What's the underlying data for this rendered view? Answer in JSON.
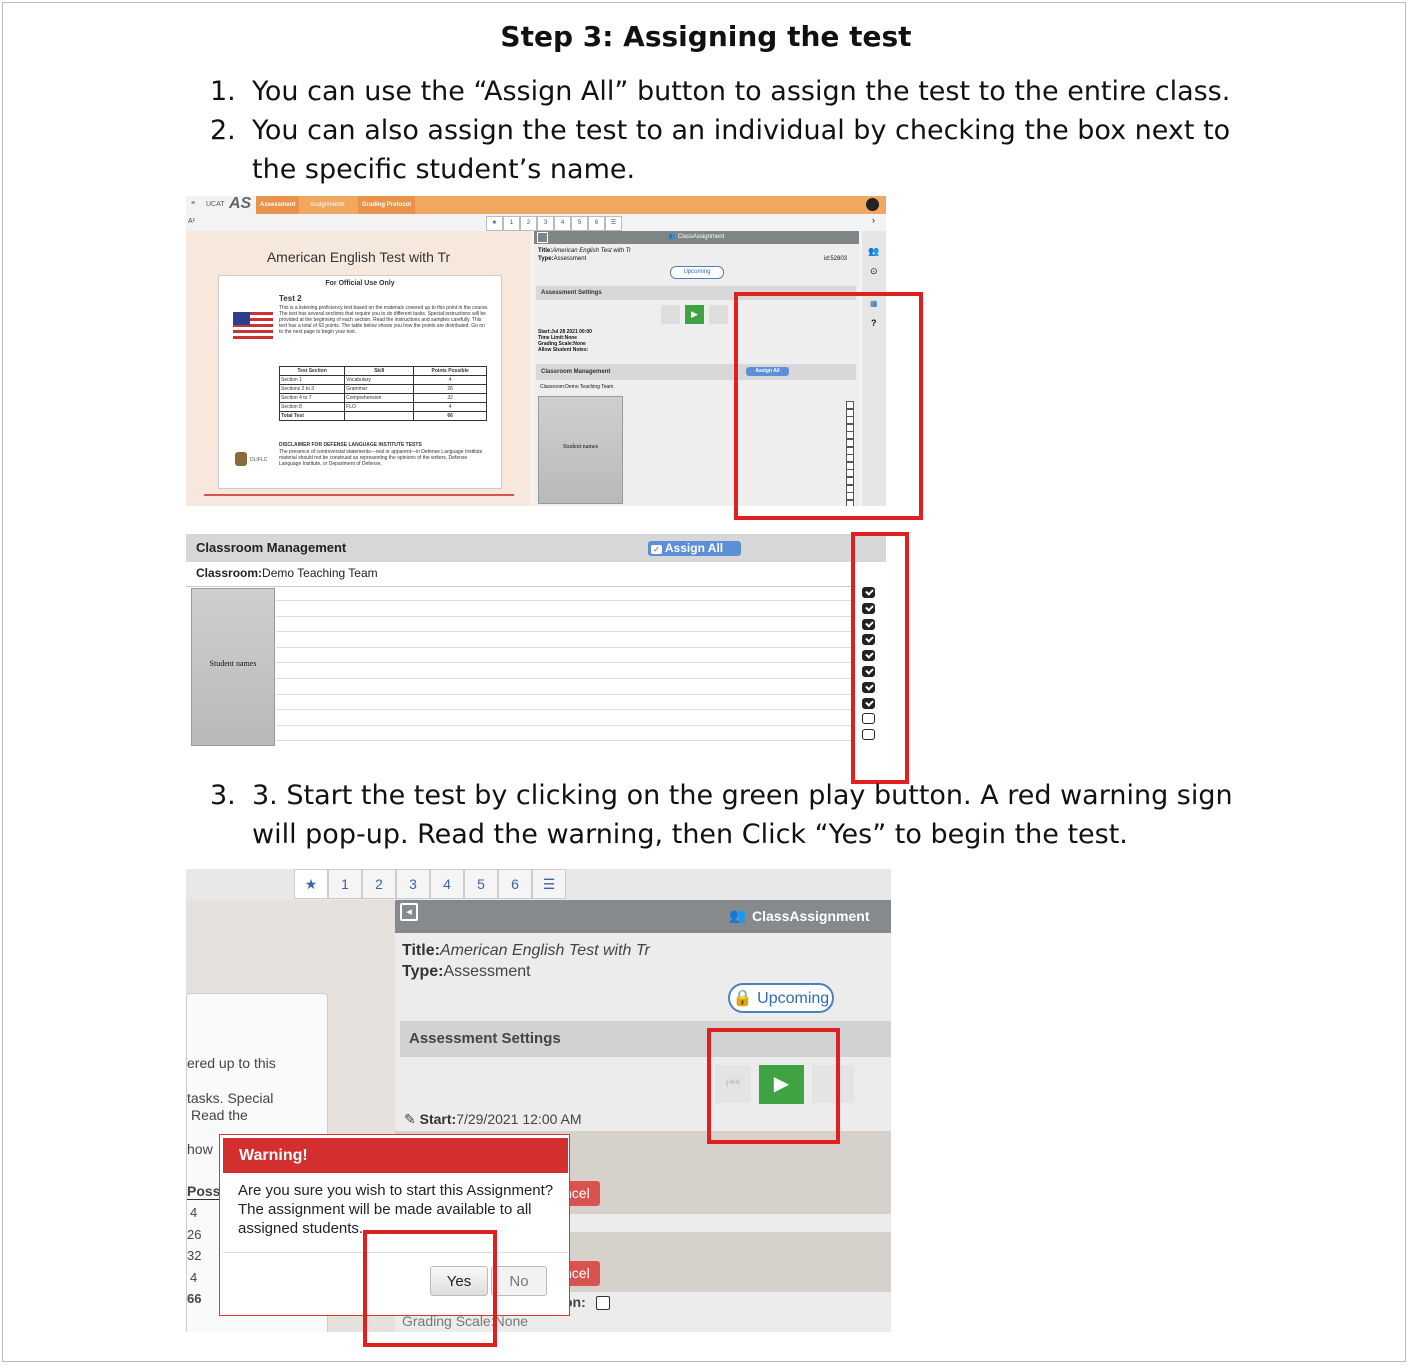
{
  "document": {
    "title": "Step 3: Assigning the test",
    "steps": [
      {
        "num": "1.",
        "text": "You can use the “Assign All” button to assign the test to the entire class."
      },
      {
        "num": "2.",
        "text": "You can also assign the test to an individual by checking the box next to the specific student’s name."
      },
      {
        "num": "3.",
        "text": "3. Start the test by clicking on the green play button. A red warning sign will pop-up. Read the warning, then  Click “Yes” to begin the test."
      }
    ]
  },
  "screenshot1": {
    "brand": "UCAT",
    "logo": "AS",
    "tabs": [
      "Assessment",
      "Assignments",
      "Grading Protocol"
    ],
    "toolbar_text": "A¹",
    "pager": [
      "1",
      "2",
      "3",
      "4",
      "5",
      "6"
    ],
    "test_title": "American English Test with Tr",
    "official": "For Official Use Only",
    "test_name": "Test 2",
    "test_desc": "This is a listening proficiency test based on the materials covered up to this point in the course. The test has several sections that require you to do different tasks. Special instructions will be provided at the beginning of each section. Read the instructions and samples carefully. This test has a total of 63 points. The table below shows you how the points are distributed. Go on to the next page to begin your test.",
    "table_headers": [
      "Test Section",
      "Skill",
      "Points Possible"
    ],
    "table_rows": [
      [
        "Section 1",
        "Vocabulary",
        "4"
      ],
      [
        "Sections 2 to 3",
        "Grammar",
        "26"
      ],
      [
        "Section 4 to 7",
        "Comprehension",
        "32"
      ],
      [
        "Section 8",
        "FLO",
        "4"
      ],
      [
        "Total Test",
        "",
        "66"
      ]
    ],
    "disclaimer_title": "DISCLAIMER FOR DEFENSE LANGUAGE INSTITUTE TESTS",
    "disclaimer_text": "The presence of controversial statements—real or apparent—in Defense Language Institute material should not be construed as representing the opinions of the writers, Defense Language Institute, or Department of Defense.",
    "dlifl": "DLIFLC",
    "panel_title": "ClassAssignment",
    "title_label": "Title:",
    "title_value": "American English Test with Tr",
    "type_label": "Type:",
    "type_value": "Assessment",
    "id_text": "id:52803",
    "upcoming": "Upcoming",
    "settings": "Assessment Settings",
    "start": "Start:Jul 28 2021 00:00",
    "time_limit": "Time Limit:None",
    "grading": "Grading Scale:None",
    "allow_notes": "Allow Student Notes:",
    "classroom_mgmt": "Classroom Management",
    "assign_all": "Assign All",
    "classroom": "Classroom:Demo Teaching Team",
    "student_names": "Student names"
  },
  "screenshot2": {
    "header": "Classroom Management",
    "assign_all": "Assign All",
    "classroom_label": "Classroom:",
    "classroom_value": "Demo Teaching Team",
    "student_names": "Student names",
    "checked": [
      true,
      true,
      true,
      true,
      true,
      true,
      true,
      true,
      false,
      false
    ]
  },
  "screenshot3": {
    "pager": [
      "1",
      "2",
      "3",
      "4",
      "5",
      "6"
    ],
    "panel_title": "ClassAssignment",
    "title_label": "Title:",
    "title_value": "American English Test with Tr",
    "type_label": "Type:",
    "type_value": "Assessment",
    "upcoming": "Upcoming",
    "settings": "Assessment Settings",
    "start_label": "Start:",
    "start_value": "7/29/2021 12:00 AM",
    "cancel_partial_1": "ncel",
    "cancel_partial_2": "ncel",
    "grading_partial": "Grading Scale:None",
    "on_partial": "on:",
    "card_lines": [
      "ered up to this",
      "tasks. Special",
      "Read the",
      "how"
    ],
    "card_col": "Poss",
    "card_values": [
      "4",
      "26",
      "32",
      "4",
      "66"
    ],
    "warning_title": "Warning!",
    "warning_text": "Are you sure you wish to start this Assignment? The assignment will be made available to all assigned students.",
    "yes": "Yes",
    "no": "No"
  },
  "colors": {
    "highlight": "#e02020",
    "warning": "#d32f2f",
    "play": "#3fa344",
    "accent": "#f0a860"
  }
}
